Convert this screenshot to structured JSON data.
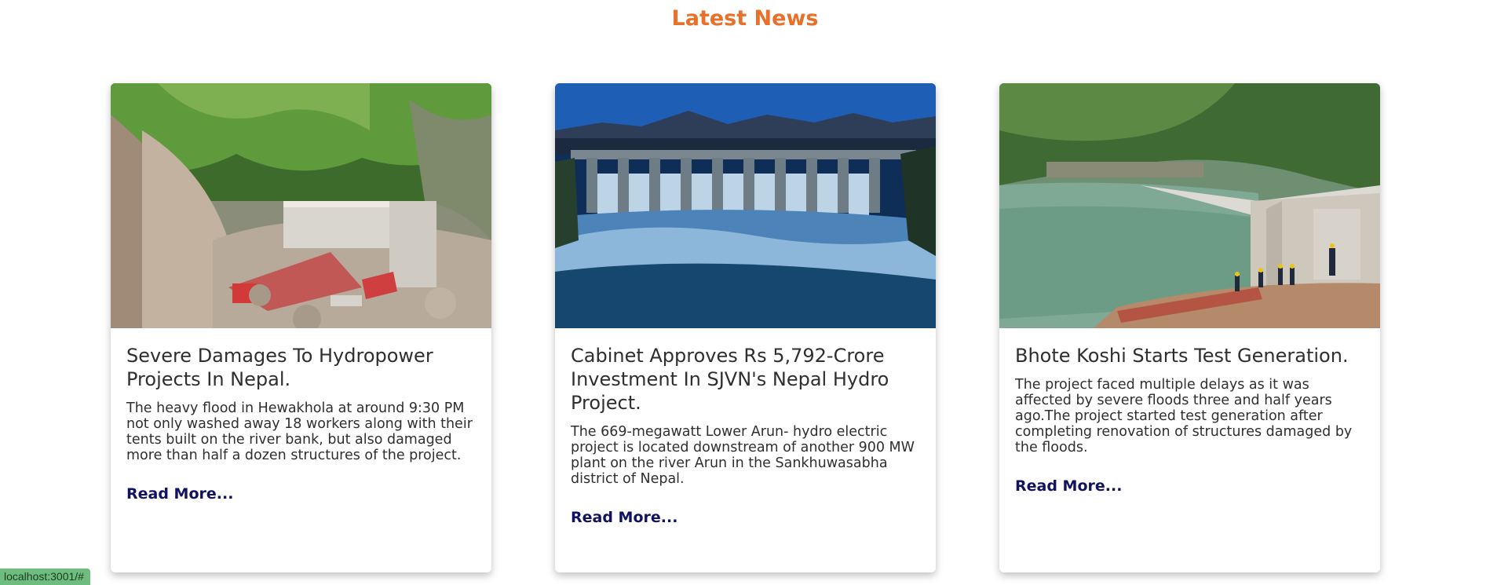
{
  "section": {
    "title": "Latest News"
  },
  "cards": [
    {
      "image_alt": "Flood damaged hydropower construction site in a rocky gorge",
      "title": "Severe Damages To Hydropower Projects In Nepal.",
      "text": "The heavy flood in Hewakhola at around 9:30 PM not only washed away 18 workers along with their tents built on the river bank, but also damaged more than half a dozen structures of the project.",
      "link_label": "Read More..."
    },
    {
      "image_alt": "Hydro dam spillway with water flowing beneath mountains at dusk",
      "title": "Cabinet Approves Rs 5,792-Crore Investment In SJVN's Nepal Hydro Project.",
      "text": "The 669-megawatt Lower Arun- hydro electric project is located downstream of another 900 MW plant on the river Arun in the Sankhuwasabha district of Nepal.",
      "link_label": "Read More..."
    },
    {
      "image_alt": "Green reservoir with concrete dam structure and workers",
      "title": "Bhote Koshi Starts Test Generation.",
      "text": "The project faced multiple delays as it was affected by severe floods three and half years ago.The project started test generation after completing renovation of structures damaged by the floods.",
      "link_label": "Read More..."
    }
  ],
  "status_bar": {
    "url": "localhost:3001/#"
  },
  "colors": {
    "title_accent": "#e8702a",
    "link": "#111262"
  }
}
